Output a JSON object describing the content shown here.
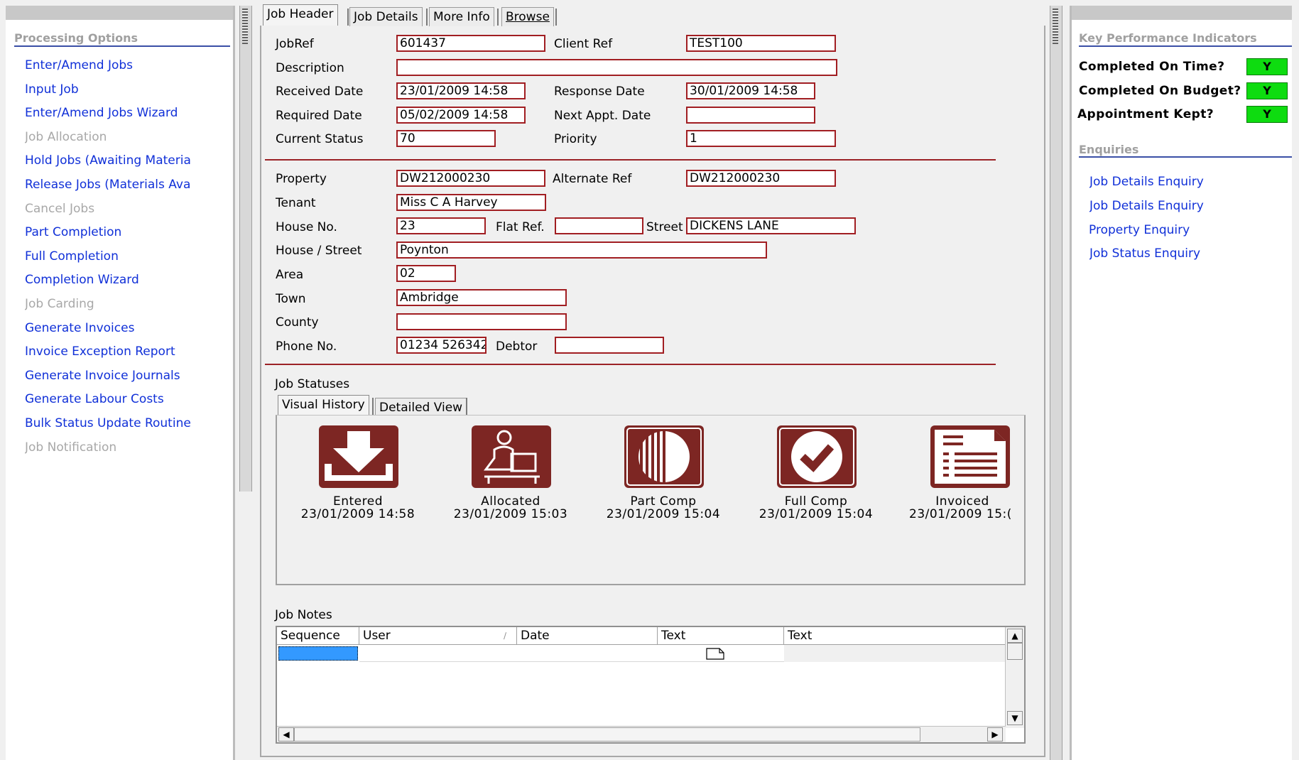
{
  "processing_options": {
    "title": "Processing Options",
    "items": [
      {
        "label": "Enter/Amend Jobs",
        "enabled": true
      },
      {
        "label": "Input Job",
        "enabled": true
      },
      {
        "label": "Enter/Amend Jobs Wizard",
        "enabled": true
      },
      {
        "label": "Job Allocation",
        "enabled": false
      },
      {
        "label": "Hold Jobs (Awaiting Materia",
        "enabled": true
      },
      {
        "label": "Release Jobs (Materials Ava",
        "enabled": true
      },
      {
        "label": "Cancel Jobs",
        "enabled": false
      },
      {
        "label": "Part Completion",
        "enabled": true
      },
      {
        "label": "Full Completion",
        "enabled": true
      },
      {
        "label": "Completion Wizard",
        "enabled": true
      },
      {
        "label": "Job Carding",
        "enabled": false
      },
      {
        "label": "Generate Invoices",
        "enabled": true
      },
      {
        "label": "Invoice Exception Report",
        "enabled": true
      },
      {
        "label": "Generate Invoice Journals",
        "enabled": true
      },
      {
        "label": "Generate Labour Costs",
        "enabled": true
      },
      {
        "label": "Bulk Status Update Routine",
        "enabled": true
      },
      {
        "label": "Job Notification",
        "enabled": false
      }
    ]
  },
  "tabs": [
    "Job Header",
    "Job Details",
    "More Info",
    "Browse"
  ],
  "job_header": {
    "jobref_label": "JobRef",
    "jobref": "601437",
    "client_ref_label": "Client Ref",
    "client_ref": "TEST100",
    "description_label": "Description",
    "description": "",
    "received_label": "Received Date",
    "received": "23/01/2009 14:58",
    "response_label": "Response Date",
    "response": "30/01/2009 14:58",
    "required_label": "Required Date",
    "required": "05/02/2009 14:58",
    "next_appt_label": "Next Appt. Date",
    "next_appt": "",
    "status_label": "Current Status",
    "status": "70",
    "priority_label": "Priority",
    "priority": "1"
  },
  "property": {
    "property_label": "Property",
    "property": "DW212000230",
    "alt_ref_label": "Alternate Ref",
    "alt_ref": "DW212000230",
    "tenant_label": "Tenant",
    "tenant": "Miss C A Harvey",
    "house_no_label": "House No.",
    "house_no": "23",
    "flat_ref_label": "Flat Ref.",
    "flat_ref": "",
    "street_label": "Street",
    "street": "DICKENS LANE",
    "house_street_label": "House / Street",
    "house_street": "Poynton",
    "area_label": "Area",
    "area": "02",
    "town_label": "Town",
    "town": "Ambridge",
    "county_label": "County",
    "county": "",
    "phone_label": "Phone No.",
    "phone": "01234 526342",
    "debtor_label": "Debtor",
    "debtor": ""
  },
  "job_statuses": {
    "title": "Job Statuses",
    "subtabs": [
      "Visual History",
      "Detailed View"
    ],
    "items": [
      {
        "name": "Entered",
        "date": "23/01/2009 14:58",
        "icon": "inbox-download-icon"
      },
      {
        "name": "Allocated",
        "date": "23/01/2009 15:03",
        "icon": "person-at-desk-icon"
      },
      {
        "name": "Part Comp",
        "date": "23/01/2009 15:04",
        "icon": "half-circle-icon"
      },
      {
        "name": "Full Comp",
        "date": "23/01/2009 15:04",
        "icon": "check-circle-icon"
      },
      {
        "name": "Invoiced",
        "date": "23/01/2009 15:(",
        "icon": "invoice-document-icon"
      }
    ]
  },
  "job_notes": {
    "title": "Job Notes",
    "columns": [
      "Sequence",
      "User",
      "Date",
      "Text",
      "Text"
    ]
  },
  "kpi": {
    "title": "Key Performance Indicators",
    "items": [
      {
        "label": "Completed On Time?",
        "value": "Y"
      },
      {
        "label": "Completed On Budget?",
        "value": "Y"
      },
      {
        "label": "Appointment Kept?",
        "value": "Y"
      }
    ],
    "indicator_color": "#0edc10"
  },
  "enquiries": {
    "title": "Enquiries",
    "items": [
      "Job Details Enquiry",
      "Job Details Enquiry",
      "Property Enquiry",
      "Job Status Enquiry"
    ]
  },
  "colors": {
    "link": "#1030d8",
    "field_border": "#a11e22",
    "icon_fill": "#7d2623"
  }
}
